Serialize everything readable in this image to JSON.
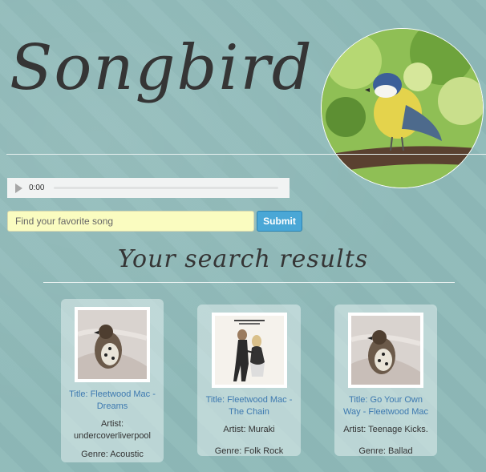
{
  "header": {
    "title": "Songbird"
  },
  "player": {
    "time": "0:00"
  },
  "search": {
    "placeholder": "Find your favorite song",
    "submit_label": "Submit"
  },
  "results": {
    "heading": "Your search results",
    "items": [
      {
        "title": "Title: Fleetwood Mac - Dreams",
        "artist": "Artist: undercoverliverpool",
        "genre": "Genre: Acoustic",
        "image": "sparrow-art"
      },
      {
        "title": "Title: Fleetwood Mac - The Chain",
        "artist": "Artist: Muraki",
        "genre": "Genre: Folk Rock",
        "image": "rumours-album-cover"
      },
      {
        "title": "Title: Go Your Own Way - Fleetwood Mac",
        "artist": "Artist: Teenage Kicks.",
        "genre": "Genre: Ballad",
        "image": "sparrow-art"
      }
    ]
  },
  "colors": {
    "background": "#8fbab9",
    "input": "#fafcc0",
    "button": "#4aa7d6",
    "link": "#3d79b0"
  }
}
